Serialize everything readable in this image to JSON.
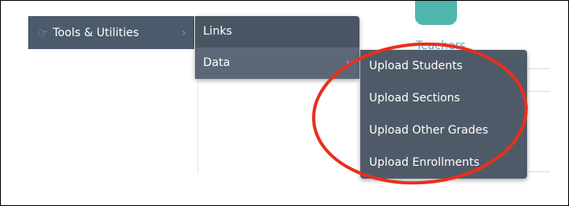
{
  "background": {
    "teachers_label": "Teachers"
  },
  "menu": {
    "main_item": {
      "label": "Tools & Utilities",
      "icon": "pointing-hand-icon",
      "chevron": "chevron-right-icon"
    },
    "submenu": [
      {
        "label": "Links"
      },
      {
        "label": "Data",
        "chevron": "chevron-right-icon"
      }
    ],
    "data_menu": [
      {
        "label": "Upload Students"
      },
      {
        "label": "Upload Sections"
      },
      {
        "label": "Upload Other Grades"
      },
      {
        "label": "Upload Enrollments"
      }
    ]
  },
  "annotation": {
    "shape": "ellipse",
    "color": "#e8301c"
  },
  "colors": {
    "menu_bg": "#4c5b6b",
    "accent": "#5aa9c9",
    "teal_icon": "#4fb6ad"
  }
}
